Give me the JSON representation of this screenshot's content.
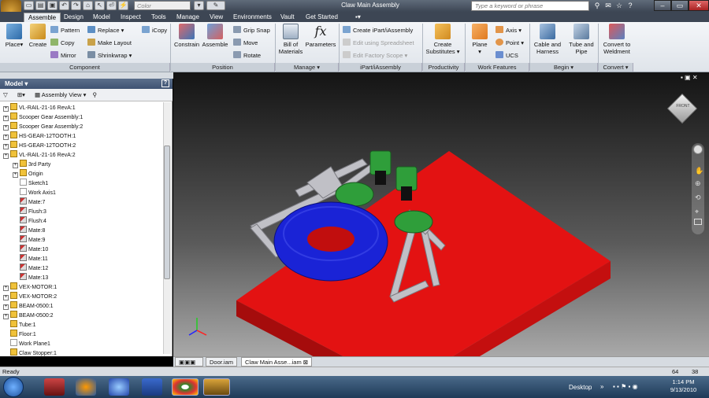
{
  "titlebar": {
    "app_badge": "PRO",
    "color_placeholder": "Color",
    "title": "Claw Main Assembly",
    "search_placeholder": "Type a keyword or phrase"
  },
  "tabs": [
    "Assemble",
    "Design",
    "Model",
    "Inspect",
    "Tools",
    "Manage",
    "View",
    "Environments",
    "Vault",
    "Get Started"
  ],
  "ribbon": {
    "component": {
      "label": "Component",
      "place": "Place",
      "create": "Create",
      "pattern": "Pattern",
      "copy": "Copy",
      "mirror": "Mirror",
      "replace": "Replace",
      "make_layout": "Make Layout",
      "shrinkwrap": "Shrinkwrap",
      "icopy": "iCopy"
    },
    "position": {
      "label": "Position",
      "constrain": "Constrain",
      "assemble": "Assemble",
      "grip_snap": "Grip Snap",
      "move": "Move",
      "rotate": "Rotate"
    },
    "manage": {
      "label": "Manage",
      "bom_line1": "Bill of",
      "bom_line2": "Materials",
      "parameters": "Parameters",
      "fx": "fx"
    },
    "ipart": {
      "label": "iPart/iAssembly",
      "create": "Create iPart/iAssembly",
      "edit_spreadsheet": "Edit using Spreadsheet",
      "edit_factory": "Edit Factory Scope"
    },
    "productivity": {
      "label": "Productivity",
      "line1": "Create",
      "line2": "Substitutes"
    },
    "work": {
      "label": "Work Features",
      "plane": "Plane",
      "axis": "Axis",
      "point": "Point",
      "ucs": "UCS"
    },
    "begin": {
      "label": "Begin",
      "cable_line1": "Cable and",
      "cable_line2": "Harness",
      "tube_line1": "Tube and",
      "tube_line2": "Pipe"
    },
    "convert": {
      "label": "Convert",
      "line1": "Convert to",
      "line2": "Weldment"
    }
  },
  "browser": {
    "title": "Model",
    "view_label": "Assembly View",
    "items": [
      {
        "label": "VL-RAIL-21-16 RevA:1",
        "icon": "y",
        "expand": true,
        "indent": 0
      },
      {
        "label": "Scooper Gear Assembly:1",
        "icon": "y",
        "expand": true,
        "indent": 0
      },
      {
        "label": "Scooper Gear Assembly:2",
        "icon": "y",
        "expand": true,
        "indent": 0
      },
      {
        "label": "HS-GEAR-12TOOTH:1",
        "icon": "y",
        "expand": true,
        "indent": 0
      },
      {
        "label": "HS-GEAR-12TOOTH:2",
        "icon": "y",
        "expand": true,
        "indent": 0
      },
      {
        "label": "VL-RAIL-21-16 RevA:2",
        "icon": "y",
        "expand": true,
        "indent": 0
      },
      {
        "label": "3rd Party",
        "icon": "y",
        "expand": true,
        "indent": 1
      },
      {
        "label": "Origin",
        "icon": "y",
        "expand": true,
        "indent": 1
      },
      {
        "label": "Sketch1",
        "icon": "bl",
        "expand": false,
        "indent": 1
      },
      {
        "label": "Work Axis1",
        "icon": "bl",
        "expand": false,
        "indent": 1
      },
      {
        "label": "Mate:7",
        "icon": "mt",
        "expand": false,
        "indent": 1
      },
      {
        "label": "Flush:3",
        "icon": "mt",
        "expand": false,
        "indent": 1
      },
      {
        "label": "Flush:4",
        "icon": "mt",
        "expand": false,
        "indent": 1
      },
      {
        "label": "Mate:8",
        "icon": "mt",
        "expand": false,
        "indent": 1
      },
      {
        "label": "Mate:9",
        "icon": "mt",
        "expand": false,
        "indent": 1
      },
      {
        "label": "Mate:10",
        "icon": "mt",
        "expand": false,
        "indent": 1
      },
      {
        "label": "Mate:11",
        "icon": "mt",
        "expand": false,
        "indent": 1
      },
      {
        "label": "Mate:12",
        "icon": "mt",
        "expand": false,
        "indent": 1
      },
      {
        "label": "Mate:13",
        "icon": "mt",
        "expand": false,
        "indent": 1
      },
      {
        "label": "VEX-MOTOR:1",
        "icon": "y",
        "expand": true,
        "indent": 0
      },
      {
        "label": "VEX-MOTOR:2",
        "icon": "y",
        "expand": true,
        "indent": 0
      },
      {
        "label": "BEAM-0500:1",
        "icon": "y",
        "expand": true,
        "indent": 0
      },
      {
        "label": "BEAM-0500:2",
        "icon": "y",
        "expand": true,
        "indent": 0
      },
      {
        "label": "Tube:1",
        "icon": "y",
        "expand": false,
        "indent": 0
      },
      {
        "label": "Floor:1",
        "icon": "y",
        "expand": false,
        "indent": 0
      },
      {
        "label": "Work Plane1",
        "icon": "bl",
        "expand": false,
        "indent": 0
      },
      {
        "label": "Claw Stopper:1",
        "icon": "y",
        "expand": false,
        "indent": 0
      }
    ]
  },
  "viewcube": {
    "label": "FRONT"
  },
  "doc_tabs": {
    "door": "Door.iam",
    "claw": "Claw Main Asse...iam"
  },
  "status": {
    "left": "Ready",
    "n1": "64",
    "n2": "38"
  },
  "taskbar": {
    "desktop": "Desktop",
    "time": "1:14 PM",
    "date": "9/13/2010"
  },
  "colors": {
    "floor": "#e31212",
    "torus": "#1a23d6",
    "brackets": "#2f9e3a",
    "rails": "#b8b8bc"
  }
}
